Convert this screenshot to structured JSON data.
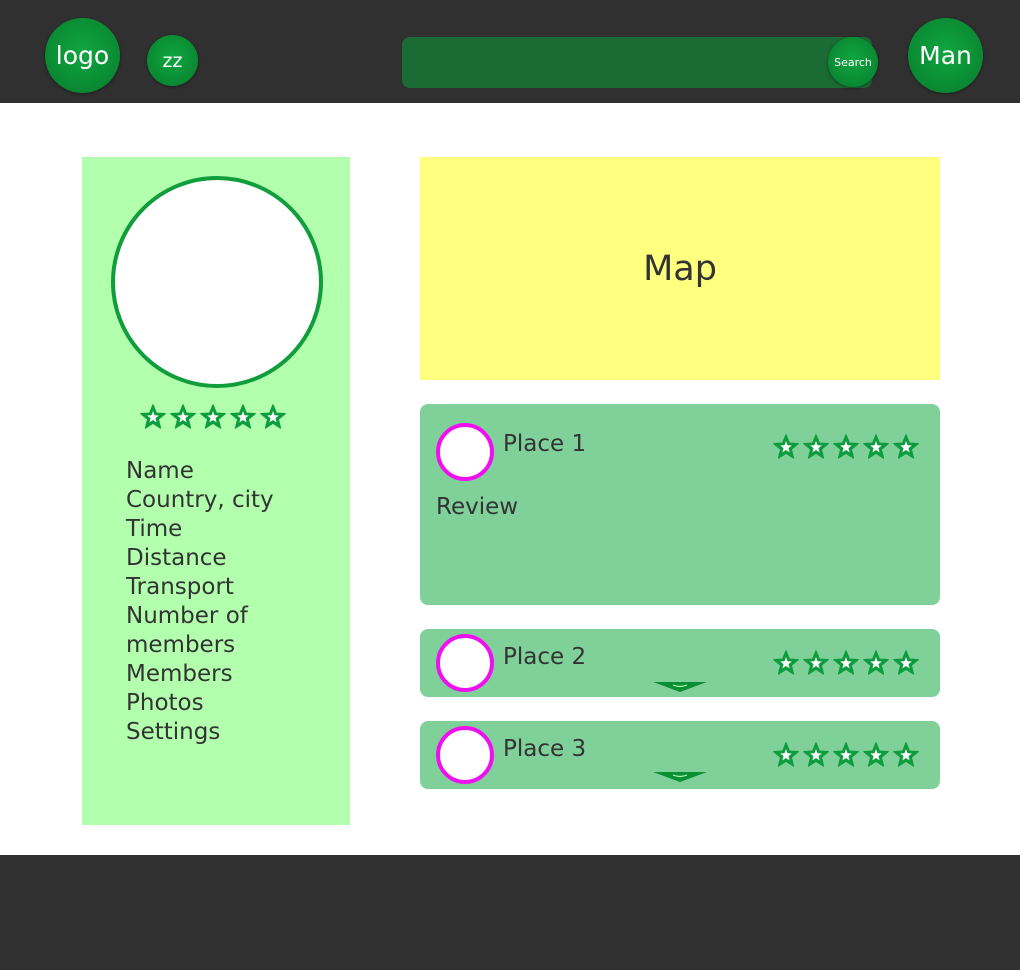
{
  "header": {
    "logo_label": "logo",
    "secondary_label": "zz",
    "search_button_label": "Search",
    "search_placeholder": "",
    "user_label": "Man"
  },
  "profile": {
    "rating_stars": 5,
    "items": [
      "Name",
      "Country, city",
      "Time",
      "Distance",
      "Transport",
      "Number of members",
      "Members",
      "Photos",
      "Settings"
    ]
  },
  "map": {
    "label": "Map"
  },
  "places": [
    {
      "title": "Place 1",
      "review": "Review",
      "rating_stars": 5,
      "expanded": true
    },
    {
      "title": "Place 2",
      "rating_stars": 5,
      "expanded": false
    },
    {
      "title": "Place 3",
      "rating_stars": 5,
      "expanded": false
    }
  ],
  "colors": {
    "header_bg": "#303030",
    "accent_green": "#0b8f35",
    "search_bg": "#1b6b35",
    "sidebar_bg": "#b2ffae",
    "map_bg": "#ffff7f",
    "card_bg": "#80d09a",
    "place_avatar_border": "#f00ff0",
    "star_fill": "#0d9d3e"
  },
  "icons": {
    "star": "star-icon",
    "expand": "chevron-down-icon"
  }
}
